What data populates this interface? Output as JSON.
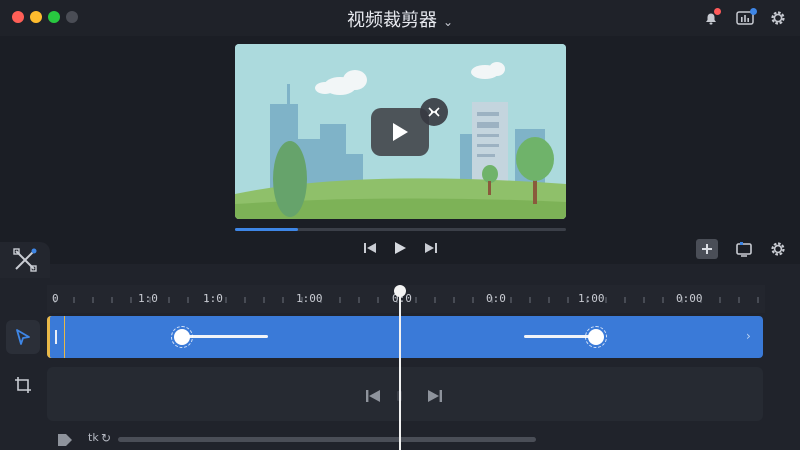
{
  "window": {
    "title": "视频裁剪器"
  },
  "ruler": {
    "labels": [
      "0",
      "1:0",
      "1:0",
      "1:00",
      "0:0",
      "0:0",
      "1:00",
      "0:00"
    ]
  },
  "playback": {
    "progress_fraction": 0.19
  },
  "footer": {
    "label": "tk"
  },
  "colors": {
    "accent": "#3a7ad8",
    "start_marker": "#e8b849",
    "close": "#fe5f57",
    "minimize": "#febc2e",
    "maximize": "#28c840"
  }
}
